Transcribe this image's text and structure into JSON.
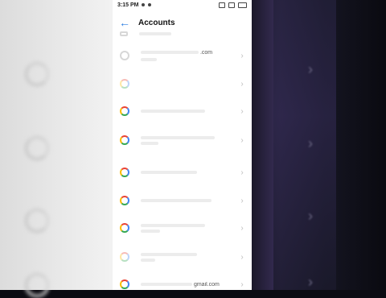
{
  "status_bar": {
    "time": "3:15 PM"
  },
  "header": {
    "back_icon": "arrow-left-icon",
    "title": "Accounts"
  },
  "accounts": [
    {
      "icon": "account-icon",
      "line1": "",
      "line2": ""
    },
    {
      "icon": "device-icon",
      "line1": ".com",
      "line2": ""
    },
    {
      "icon": "google-icon",
      "line1": "",
      "line2": ""
    },
    {
      "icon": "google-icon",
      "line1": "",
      "line2": ""
    },
    {
      "icon": "google-icon",
      "line1": "",
      "line2": ""
    },
    {
      "icon": "google-icon",
      "line1": "",
      "line2": ""
    },
    {
      "icon": "google-icon",
      "line1": "",
      "line2": ""
    },
    {
      "icon": "google-icon",
      "line1": "",
      "line2": ""
    },
    {
      "icon": "google-icon",
      "line1": "",
      "line2": ""
    },
    {
      "icon": "google-icon",
      "line1": "gmail.com",
      "line2": ""
    }
  ],
  "colors": {
    "accent": "#2b7de0",
    "google_red": "#ea4335",
    "google_blue": "#4285f4",
    "google_green": "#34a853",
    "google_yellow": "#fbbc05"
  }
}
